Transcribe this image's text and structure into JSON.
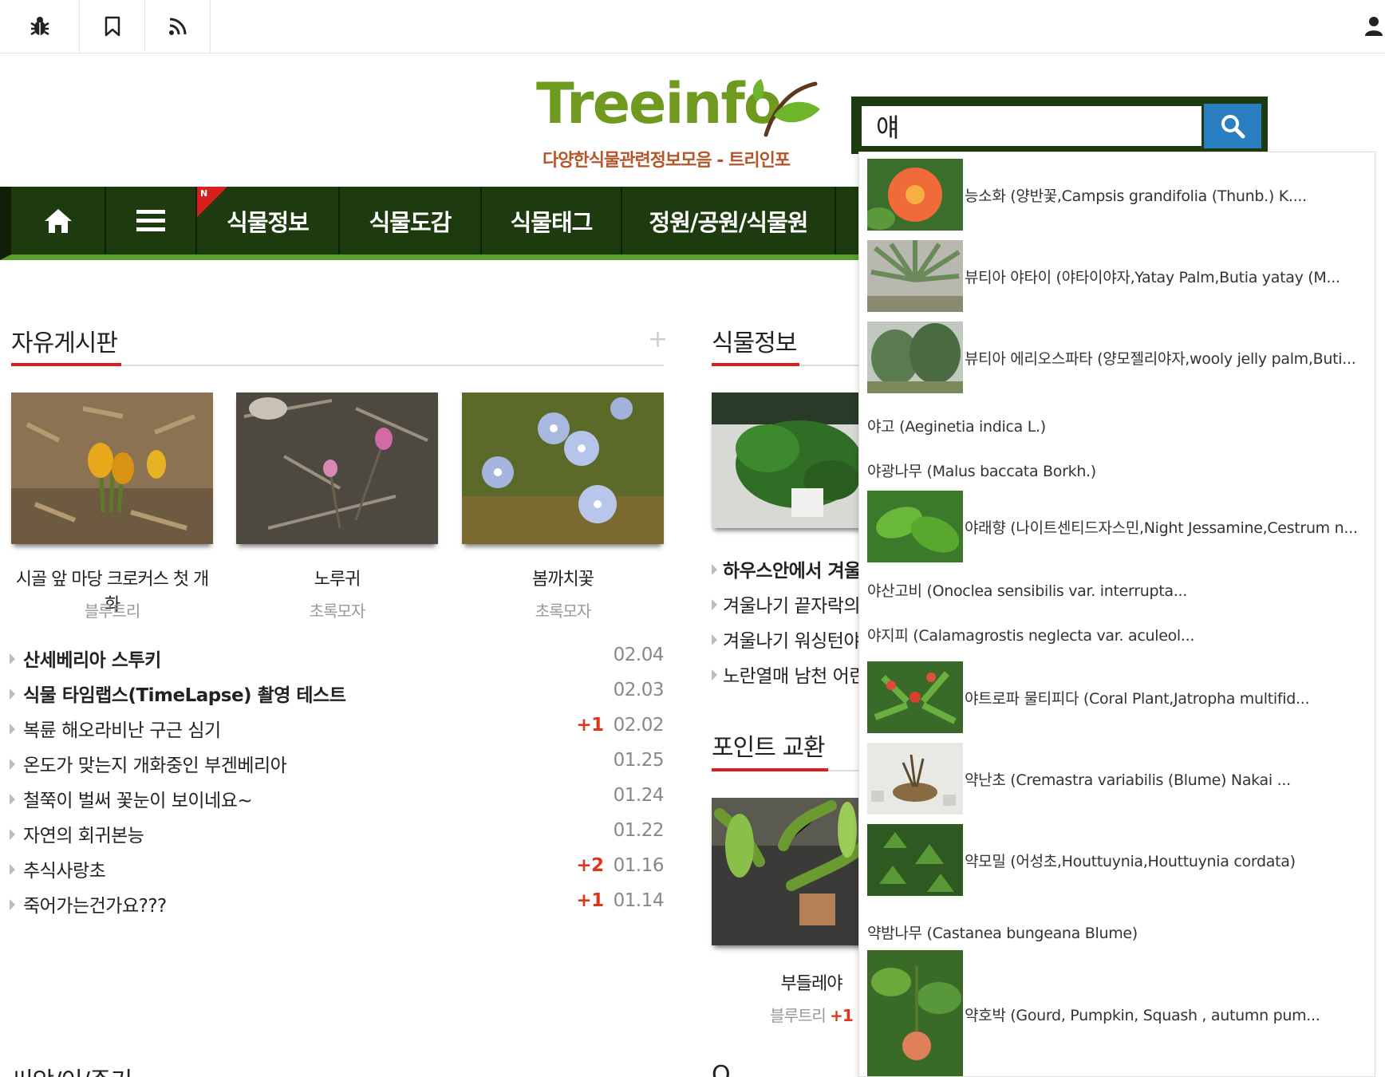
{
  "topbar": {
    "icons": [
      "bug-icon",
      "bookmark-icon",
      "rss-icon",
      "user-icon"
    ]
  },
  "logo": {
    "wordmark": "Treeinfo",
    "subtitle": "다양한식물관련정보모음 - 트리인포"
  },
  "search": {
    "value": "얘",
    "button_icon": "search-icon"
  },
  "nav": {
    "home_icon": "home-icon",
    "menu_icon": "hamburger-icon",
    "badge": "N",
    "items": [
      "식물정보",
      "식물도감",
      "식물태그",
      "정원/공원/식물원"
    ]
  },
  "free_board": {
    "title": "자유게시판",
    "more": "+",
    "gallery": [
      {
        "caption": "시골 앞 마당 크로커스 첫 개화",
        "author": "블루트리"
      },
      {
        "caption": "노루귀",
        "author": "초록모자"
      },
      {
        "caption": "봄까치꽃",
        "author": "초록모자"
      }
    ],
    "list": [
      {
        "title": "산세베리아 스투키",
        "bold": true,
        "count": "",
        "date": "02.04"
      },
      {
        "title": "식물 타임랩스(TimeLapse) 촬영 테스트",
        "bold": true,
        "count": "",
        "date": "02.03"
      },
      {
        "title": "복륜 해오라비난 구근 심기",
        "bold": false,
        "count": "+1",
        "date": "02.02"
      },
      {
        "title": "온도가 맞는지 개화중인 부겐베리아",
        "bold": false,
        "count": "",
        "date": "01.25"
      },
      {
        "title": "철쭉이 벌써 꽃눈이 보이네요~",
        "bold": false,
        "count": "",
        "date": "01.24"
      },
      {
        "title": "자연의 회귀본능",
        "bold": false,
        "count": "",
        "date": "01.22"
      },
      {
        "title": "추식사랑초",
        "bold": false,
        "count": "+2",
        "date": "01.16"
      },
      {
        "title": "죽어가는건가요???",
        "bold": false,
        "count": "+1",
        "date": "01.14"
      }
    ]
  },
  "plant_info": {
    "title": "식물정보",
    "list": [
      {
        "title": "하우스안에서 겨울을",
        "bold": true
      },
      {
        "title": "겨울나기 끝자락의",
        "bold": false
      },
      {
        "title": "겨울나기 워싱턴야",
        "bold": false
      },
      {
        "title": "노란열매 남천 어린",
        "bold": false
      }
    ]
  },
  "point_exchange": {
    "title": "포인트 교환",
    "item": {
      "caption": "부들레야",
      "author": "블루트리",
      "count": "+1"
    }
  },
  "bottom_partial": {
    "left": "씨앗/이/주기",
    "right": "Q..."
  },
  "dropdown": [
    {
      "text": "능소화 (양반꽃,Campsis grandifolia (Thunb.) K....",
      "img": true
    },
    {
      "text": "뷰티아 야타이 (야타이야자,Yatay Palm,Butia yatay (M...",
      "img": true
    },
    {
      "text": "뷰티아 에리오스파타 (양모젤리야자,wooly jelly palm,Buti...",
      "img": true
    },
    {
      "text": "야고 (Aeginetia indica L.)",
      "img": false
    },
    {
      "text": "야광나무 (Malus baccata Borkh.)",
      "img": false
    },
    {
      "text": "야래향 (나이트센티드자스민,Night Jessamine,Cestrum n...",
      "img": true
    },
    {
      "text": "야산고비 (Onoclea sensibilis var. interrupta...",
      "img": false
    },
    {
      "text": "야지피 (Calamagrostis neglecta var. aculeol...",
      "img": false
    },
    {
      "text": "야트로파 물티피다 (Coral Plant,Jatropha multifid...",
      "img": true
    },
    {
      "text": "약난초 (Cremastra variabilis (Blume) Nakai ...",
      "img": true
    },
    {
      "text": "약모밀 (어성초,Houttuynia,Houttuynia cordata)",
      "img": true
    },
    {
      "text": "약밤나무 (Castanea bungeana Blume)",
      "img": false
    },
    {
      "text": "약호박 (Gourd, Pumpkin, Squash , autumn pum...",
      "img": true
    }
  ],
  "colors": {
    "nav_bg": "#1e3a0f",
    "nav_accent": "#5aa02c",
    "accent_red": "#d91e1e",
    "search_btn": "#2a7fc2",
    "count_red": "#e0351b"
  }
}
